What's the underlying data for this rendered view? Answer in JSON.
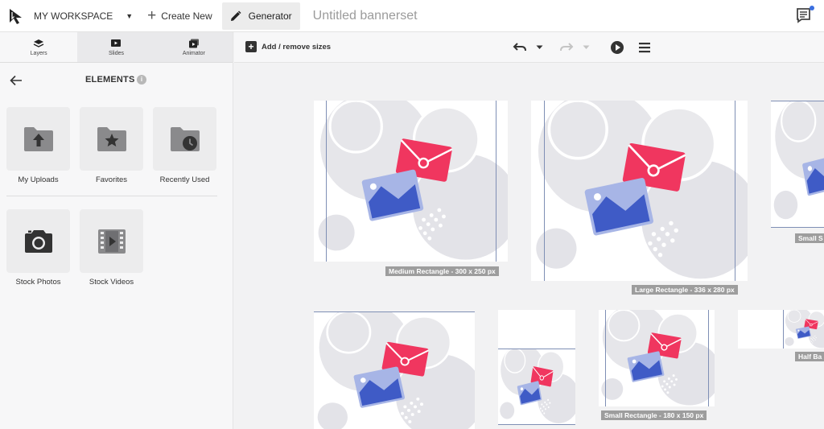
{
  "header": {
    "workspace": "MY WORKSPACE",
    "create_new": "Create New",
    "generator": "Generator",
    "doc_title": "Untitled bannerset"
  },
  "sidebar": {
    "tabs": [
      {
        "label": "Layers",
        "icon": "layers-icon",
        "active": true
      },
      {
        "label": "Slides",
        "icon": "slides-icon",
        "active": false
      },
      {
        "label": "Animator",
        "icon": "animator-icon",
        "active": false
      }
    ],
    "title": "ELEMENTS",
    "tiles": [
      {
        "label": "My Uploads",
        "icon": "folder-upload-icon"
      },
      {
        "label": "Favorites",
        "icon": "folder-star-icon"
      },
      {
        "label": "Recently Used",
        "icon": "folder-clock-icon"
      },
      {
        "label": "Stock Photos",
        "icon": "camera-icon"
      },
      {
        "label": "Stock Videos",
        "icon": "film-icon"
      }
    ]
  },
  "toolbar": {
    "add_sizes": "Add / remove sizes"
  },
  "banners": {
    "medium_rectangle": "Medium Rectangle - 300 x 250 px",
    "large_rectangle": "Large Rectangle - 336 x 280 px",
    "small_square": "Small S",
    "small_rectangle": "Small Rectangle - 180 x 150 px",
    "half_banner": "Half Ba"
  },
  "colors": {
    "accent_red": "#f0365f",
    "accent_blue": "#3f5bc6",
    "accent_lightblue": "#a7b5e6",
    "circle_gray": "#e3e3e8"
  }
}
